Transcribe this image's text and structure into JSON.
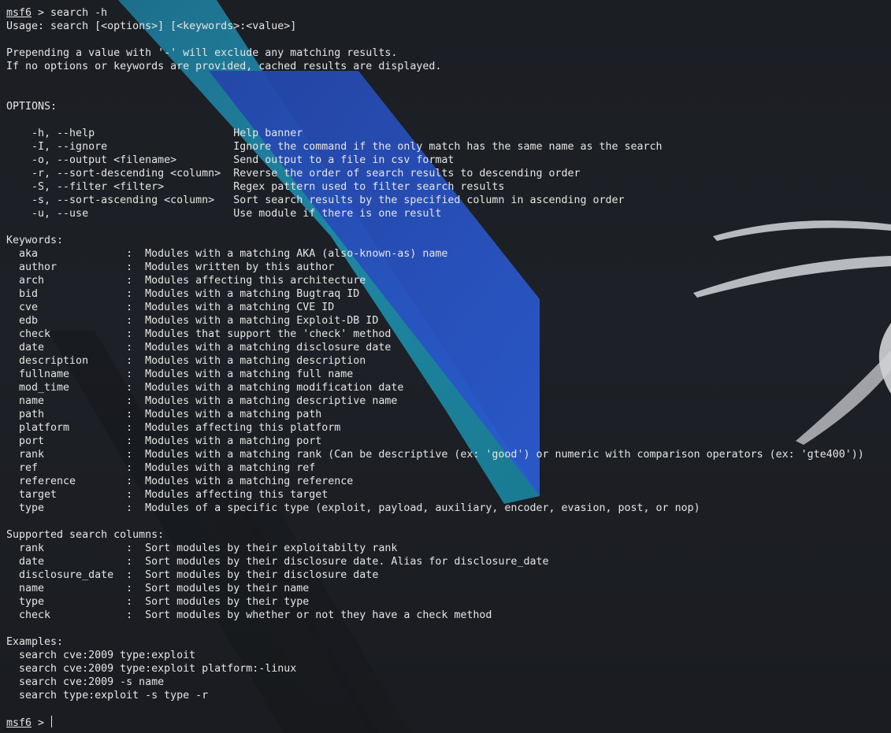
{
  "terminal": {
    "prompt_name": "msf6",
    "prompt_suffix": " > search -h",
    "usage": "Usage: search [<options>] [<keywords>:<value>]",
    "info": [
      "Prepending a value with '-' will exclude any matching results.",
      "If no options or keywords are provided, cached results are displayed."
    ],
    "options_header": "OPTIONS:",
    "options": [
      "    -h, --help                      Help banner",
      "    -I, --ignore                    Ignore the command if the only match has the same name as the search",
      "    -o, --output <filename>         Send output to a file in csv format",
      "    -r, --sort-descending <column>  Reverse the order of search results to descending order",
      "    -S, --filter <filter>           Regex pattern used to filter search results",
      "    -s, --sort-ascending <column>   Sort search results by the specified column in ascending order",
      "    -u, --use                       Use module if there is one result"
    ],
    "keywords_header": "Keywords:",
    "keywords": [
      "  aka              :  Modules with a matching AKA (also-known-as) name",
      "  author           :  Modules written by this author",
      "  arch             :  Modules affecting this architecture",
      "  bid              :  Modules with a matching Bugtraq ID",
      "  cve              :  Modules with a matching CVE ID",
      "  edb              :  Modules with a matching Exploit-DB ID",
      "  check            :  Modules that support the 'check' method",
      "  date             :  Modules with a matching disclosure date",
      "  description      :  Modules with a matching description",
      "  fullname         :  Modules with a matching full name",
      "  mod_time         :  Modules with a matching modification date",
      "  name             :  Modules with a matching descriptive name",
      "  path             :  Modules with a matching path",
      "  platform         :  Modules affecting this platform",
      "  port             :  Modules with a matching port",
      "  rank             :  Modules with a matching rank (Can be descriptive (ex: 'good') or numeric with comparison operators (ex: 'gte400'))",
      "  ref              :  Modules with a matching ref",
      "  reference        :  Modules with a matching reference",
      "  target           :  Modules affecting this target",
      "  type             :  Modules of a specific type (exploit, payload, auxiliary, encoder, evasion, post, or nop)"
    ],
    "columns_header": "Supported search columns:",
    "columns": [
      "  rank             :  Sort modules by their exploitabilty rank",
      "  date             :  Sort modules by their disclosure date. Alias for disclosure_date",
      "  disclosure_date  :  Sort modules by their disclosure date",
      "  name             :  Sort modules by their name",
      "  type             :  Sort modules by their type",
      "  check            :  Sort modules by whether or not they have a check method"
    ],
    "examples_header": "Examples:",
    "examples": [
      "  search cve:2009 type:exploit",
      "  search cve:2009 type:exploit platform:-linux",
      "  search cve:2009 -s name",
      "  search type:exploit -s type -r"
    ],
    "final_prompt_name": "msf6",
    "final_prompt_suffix": " > "
  },
  "colors": {
    "background": "#1b1e23",
    "text": "#e6e6e6",
    "stripe_light": "#1f8fa6",
    "stripe_dark": "#2a55c4"
  }
}
